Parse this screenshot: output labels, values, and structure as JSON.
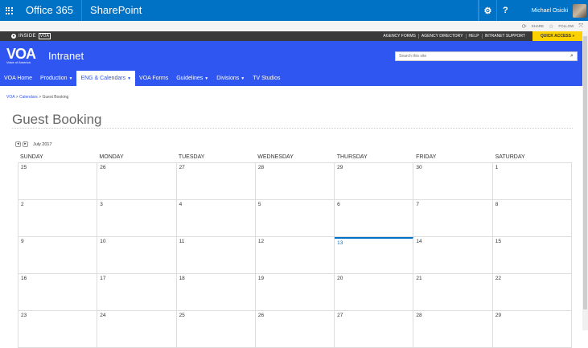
{
  "suite": {
    "office": "Office 365",
    "app": "SharePoint",
    "user": "Michael Osicki",
    "help": "?"
  },
  "actions": {
    "share": "SHARE",
    "follow": "FOLLOW"
  },
  "topnav": {
    "inside": "INSIDE",
    "links": [
      "AGENCY FORMS",
      "AGENCY DIRECTORY",
      "HELP",
      "INTRANET SUPPORT"
    ],
    "quick_access": "QUICK ACCESS »"
  },
  "banner": {
    "logo": "VOA",
    "logo_sub": "Voice of America",
    "title": "Intranet",
    "search_placeholder": "Search this site"
  },
  "nav": [
    {
      "label": "VOA Home",
      "dropdown": false,
      "active": false
    },
    {
      "label": "Production",
      "dropdown": true,
      "active": false
    },
    {
      "label": "ENG & Calendars",
      "dropdown": true,
      "active": true
    },
    {
      "label": "VOA Forms",
      "dropdown": false,
      "active": false
    },
    {
      "label": "Guidelines",
      "dropdown": true,
      "active": false
    },
    {
      "label": "Divisions",
      "dropdown": true,
      "active": false
    },
    {
      "label": "TV Studios",
      "dropdown": false,
      "active": false
    }
  ],
  "breadcrumb": {
    "root": "VOA",
    "section": "Calendars",
    "current": "Guest Booking",
    "sep": ">"
  },
  "page": {
    "title": "Guest Booking"
  },
  "calendar": {
    "month": "July 2017",
    "days": [
      "SUNDAY",
      "MONDAY",
      "TUESDAY",
      "WEDNESDAY",
      "THURSDAY",
      "FRIDAY",
      "SATURDAY"
    ],
    "weeks": [
      [
        "25",
        "26",
        "27",
        "28",
        "29",
        "30",
        "1"
      ],
      [
        "2",
        "3",
        "4",
        "5",
        "6",
        "7",
        "8"
      ],
      [
        "9",
        "10",
        "11",
        "12",
        "13",
        "14",
        "15"
      ],
      [
        "16",
        "17",
        "18",
        "19",
        "20",
        "21",
        "22"
      ],
      [
        "23",
        "24",
        "25",
        "26",
        "27",
        "28",
        "29"
      ]
    ],
    "today": "13"
  }
}
